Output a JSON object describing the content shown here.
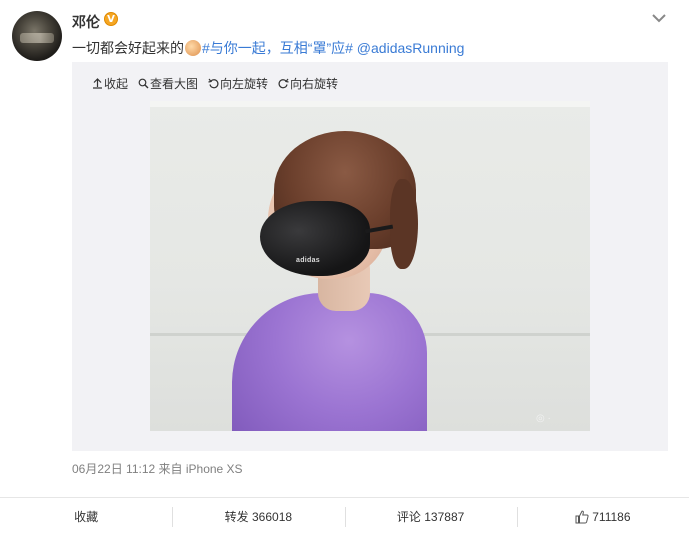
{
  "user": {
    "name": "邓伦",
    "badge": "V"
  },
  "post": {
    "text_prefix": "一切都会好起来的",
    "hashtag": "#与你一起，互相“罩”应#",
    "mention": "@adidasRunning"
  },
  "media_toolbar": {
    "collapse": "收起",
    "view_large": "查看大图",
    "rotate_left": "向左旋转",
    "rotate_right": "向右旋转"
  },
  "image": {
    "brand_on_mask": "adidas"
  },
  "meta": {
    "time": "06月22日 11:12",
    "source": "来自 iPhone XS"
  },
  "actions": {
    "favorite": "收藏",
    "repost": "转发 366018",
    "comment": "评论 137887",
    "like": "711186"
  },
  "colors": {
    "link": "#3a7bd5",
    "badge": "#f5a623"
  },
  "icons": [
    "chevron-down-icon",
    "collapse-icon",
    "zoom-icon",
    "rotate-left-icon",
    "rotate-right-icon",
    "thumbs-up-icon"
  ]
}
